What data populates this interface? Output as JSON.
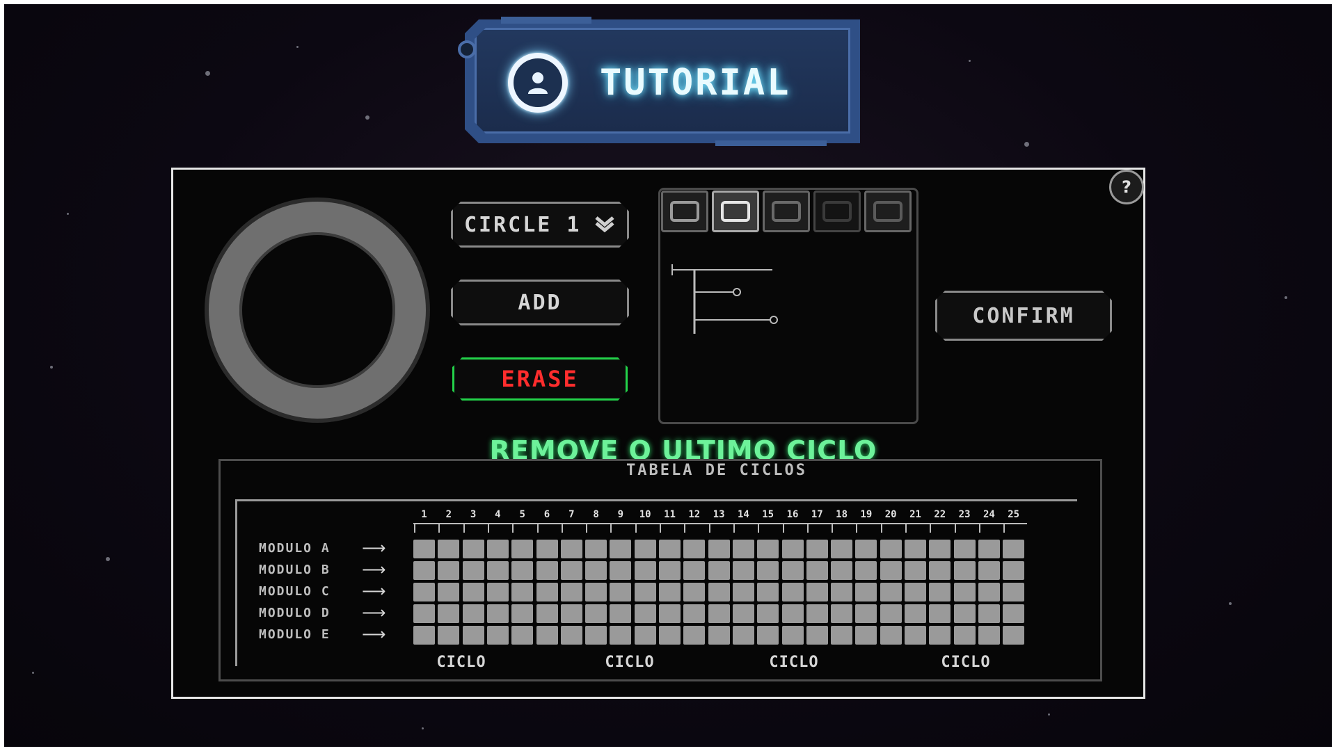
{
  "header": {
    "title": "TUTORIAL",
    "icon": "user-icon"
  },
  "help": {
    "label": "?",
    "icon": "help-icon"
  },
  "controls": {
    "shape_select": {
      "value": "CIRCLE 1",
      "icon": "chevron-down-icon"
    },
    "add_label": "ADD",
    "erase_label": "ERASE",
    "erase_hint": "REMOVE O ULTIMO CICLO CRIADO",
    "confirm_label": "CONFIRM"
  },
  "shape_selector": {
    "swatches": [
      "shape-1",
      "shape-2",
      "shape-3",
      "shape-4",
      "shape-5"
    ]
  },
  "table": {
    "title": "TABELA DE CICLOS",
    "columns": [
      "1",
      "2",
      "3",
      "4",
      "5",
      "6",
      "7",
      "8",
      "9",
      "10",
      "11",
      "12",
      "13",
      "14",
      "15",
      "16",
      "17",
      "18",
      "19",
      "20",
      "21",
      "22",
      "23",
      "24",
      "25"
    ],
    "rows": [
      {
        "label": "MODULO A"
      },
      {
        "label": "MODULO B"
      },
      {
        "label": "MODULO C"
      },
      {
        "label": "MODULO D"
      },
      {
        "label": "MODULO E"
      }
    ],
    "footer": [
      "CICLO",
      "CICLO",
      "CICLO",
      "CICLO"
    ]
  },
  "colors": {
    "accent": "#4a6da8",
    "erase_border": "#23d34a",
    "erase_text": "#ff2d2d",
    "hint": "#6df29a",
    "cell": "#9a9a9a"
  }
}
